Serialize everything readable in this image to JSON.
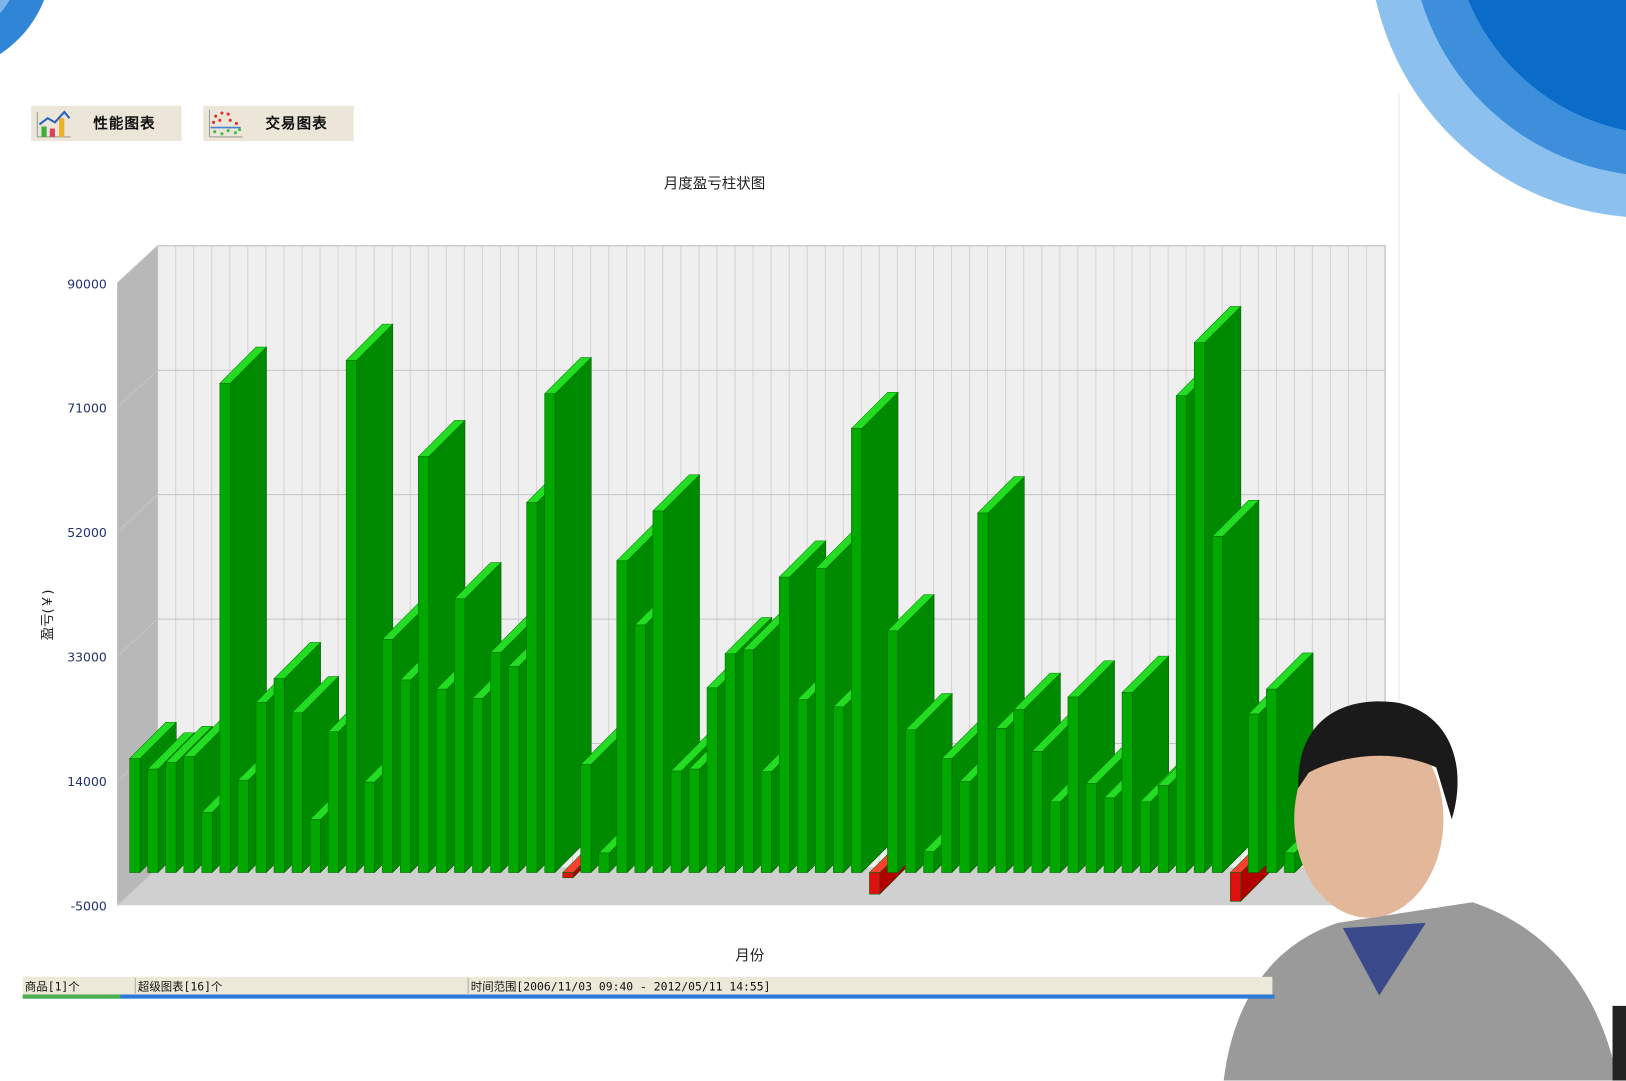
{
  "toolbar": {
    "perf_chart": "性能图表",
    "trade_chart": "交易图表"
  },
  "status": {
    "goods": "商品[1]个",
    "super_charts": "超级图表[16]个",
    "time_range": "时间范围[2006/11/03 09:40 - 2012/05/11 14:55]"
  },
  "colors": {
    "positive": "#00a800",
    "negative": "#e01010",
    "wall": "#efefef"
  },
  "chart_data": {
    "type": "bar",
    "title": "月度盈亏柱状图",
    "xlabel": "月份",
    "ylabel": "盈亏(￥)",
    "ylim": [
      -5000,
      90000
    ],
    "yticks": [
      90000,
      71000,
      52000,
      33000,
      14000,
      -5000
    ],
    "grid": true,
    "values": [
      17400,
      15800,
      16800,
      17700,
      9200,
      74700,
      14100,
      26000,
      29600,
      24400,
      8100,
      21500,
      78200,
      13800,
      35600,
      29400,
      63500,
      28000,
      41800,
      26600,
      33600,
      31500,
      56500,
      73100,
      -800,
      16500,
      3000,
      47600,
      37800,
      55200,
      15500,
      15800,
      28200,
      33400,
      34000,
      15400,
      45100,
      26400,
      46400,
      25300,
      67800,
      -3300,
      36900,
      21800,
      3200,
      17400,
      13900,
      54900,
      22000,
      24900,
      18500,
      10800,
      26800,
      13600,
      11400,
      27500,
      10800,
      13300,
      72800,
      80900,
      51300,
      -4400,
      24200,
      28000,
      3000
    ]
  }
}
